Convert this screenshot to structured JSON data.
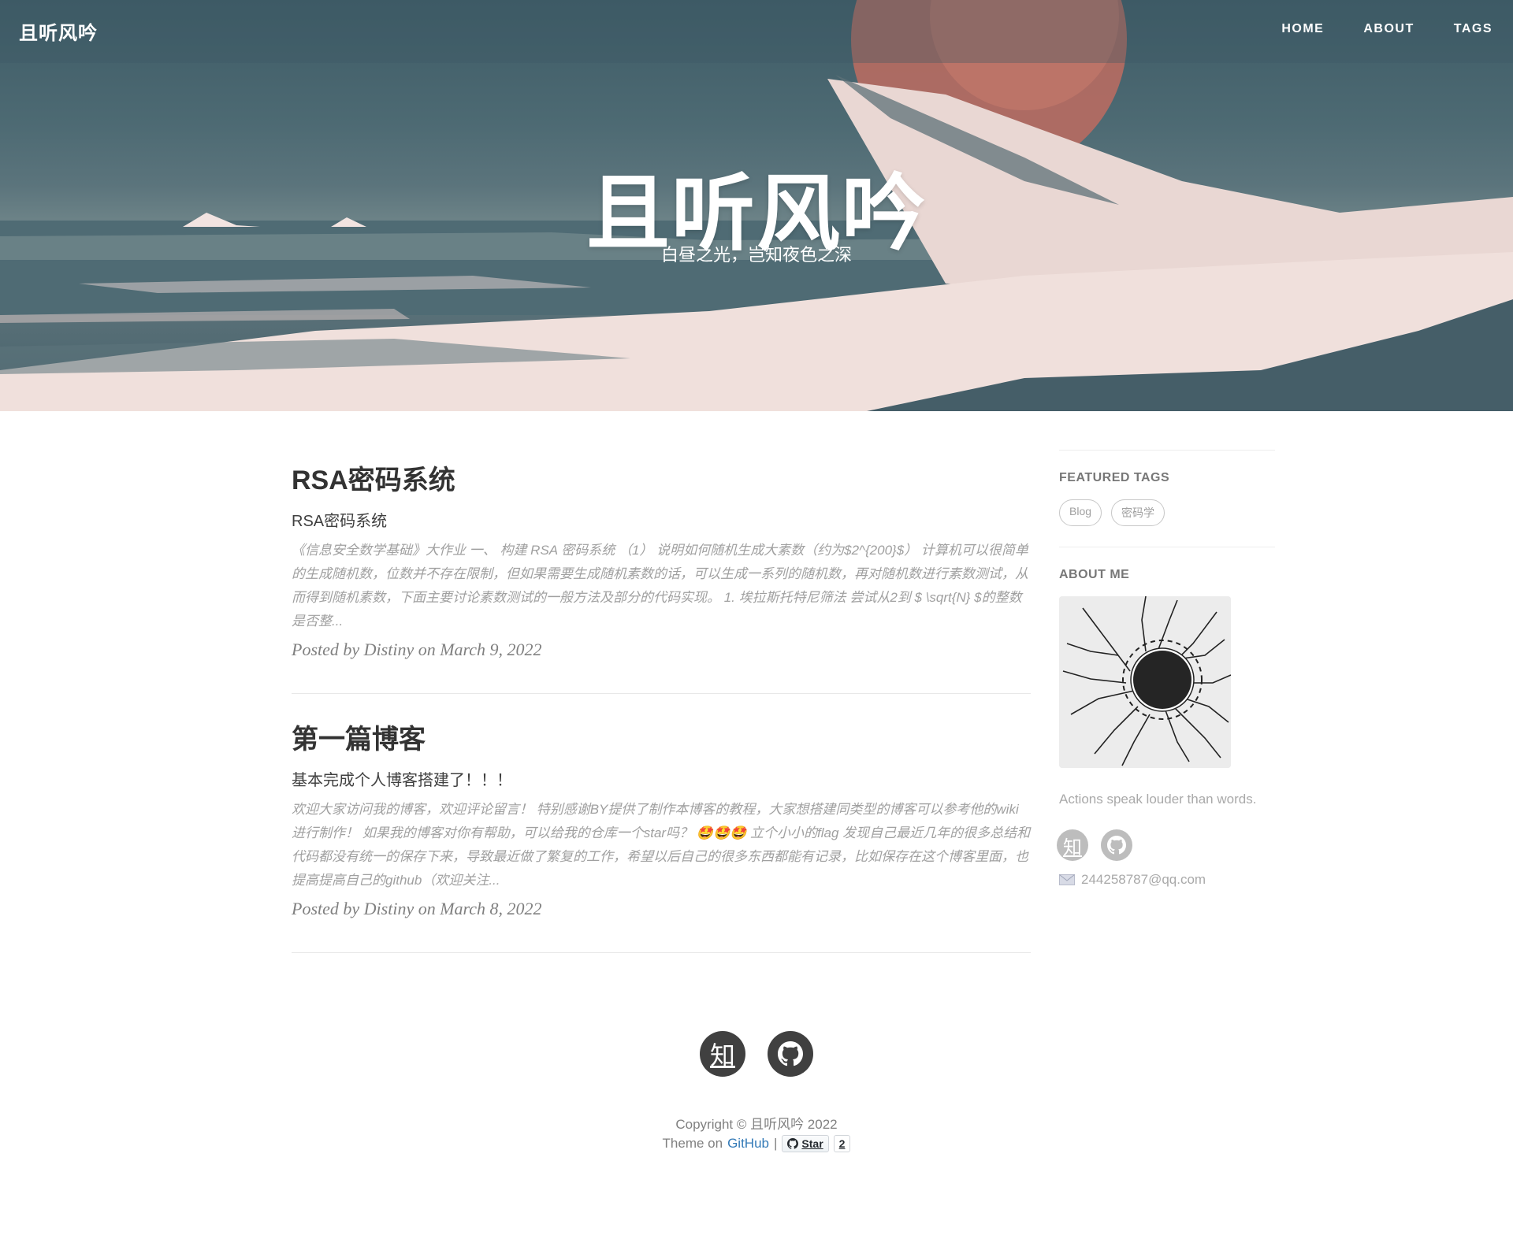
{
  "nav": {
    "brand": "且听风吟",
    "links": [
      {
        "label": "HOME"
      },
      {
        "label": "ABOUT"
      },
      {
        "label": "TAGS"
      }
    ]
  },
  "hero": {
    "title": "且听风吟",
    "subtitle": "白昼之光，岂知夜色之深"
  },
  "posts": [
    {
      "title": "RSA密码系统",
      "subtitle": "RSA密码系统",
      "excerpt": "《信息安全数学基础》大作业 一、 构建 RSA 密码系统 （1） 说明如何随机生成大素数（约为$2^{200}$） 计算机可以很简单的生成随机数，位数并不存在限制，但如果需要生成随机素数的话，可以生成一系列的随机数，再对随机数进行素数测试，从而得到随机素数，下面主要讨论素数测试的一般方法及部分的代码实现。 1. 埃拉斯托特尼筛法 尝试从2到 $ \\sqrt{N} $的整数是否整...",
      "meta_prefix": "Posted by ",
      "author": "Distiny",
      "meta_mid": " on ",
      "date": "March 9, 2022"
    },
    {
      "title": "第一篇博客",
      "subtitle": "基本完成个人博客搭建了！！！",
      "excerpt": "欢迎大家访问我的博客，欢迎评论留言！ 特别感谢BY提供了制作本博客的教程，大家想搭建同类型的博客可以参考他的wiki进行制作！ 如果我的博客对你有帮助，可以给我的仓库一个star吗？ 🤩🤩🤩 立个小小的flag 发现自己最近几年的很多总结和代码都没有统一的保存下来，导致最近做了繁复的工作，希望以后自己的很多东西都能有记录，比如保存在这个博客里面，也提高提高自己的github（欢迎关注...",
      "meta_prefix": "Posted by ",
      "author": "Distiny",
      "meta_mid": " on ",
      "date": "March 8, 2022"
    }
  ],
  "sidebar": {
    "featured_tags_heading": "FEATURED TAGS",
    "tags": [
      "Blog",
      "密码学"
    ],
    "about_heading": "ABOUT ME",
    "motto": "Actions speak louder than words.",
    "zhihu_glyph": "知",
    "email": "244258787@qq.com"
  },
  "footer": {
    "zhihu_glyph": "知",
    "copyright": "Copyright © 且听风吟 2022",
    "theme_prefix": "Theme on",
    "theme_link": "GitHub",
    "separator": "|",
    "star_label": "Star",
    "star_count": "2"
  },
  "colors": {
    "link": "#337ab7",
    "footer_icon_bg": "#404040",
    "sidebar_icon_bg": "#bdbdbd"
  }
}
